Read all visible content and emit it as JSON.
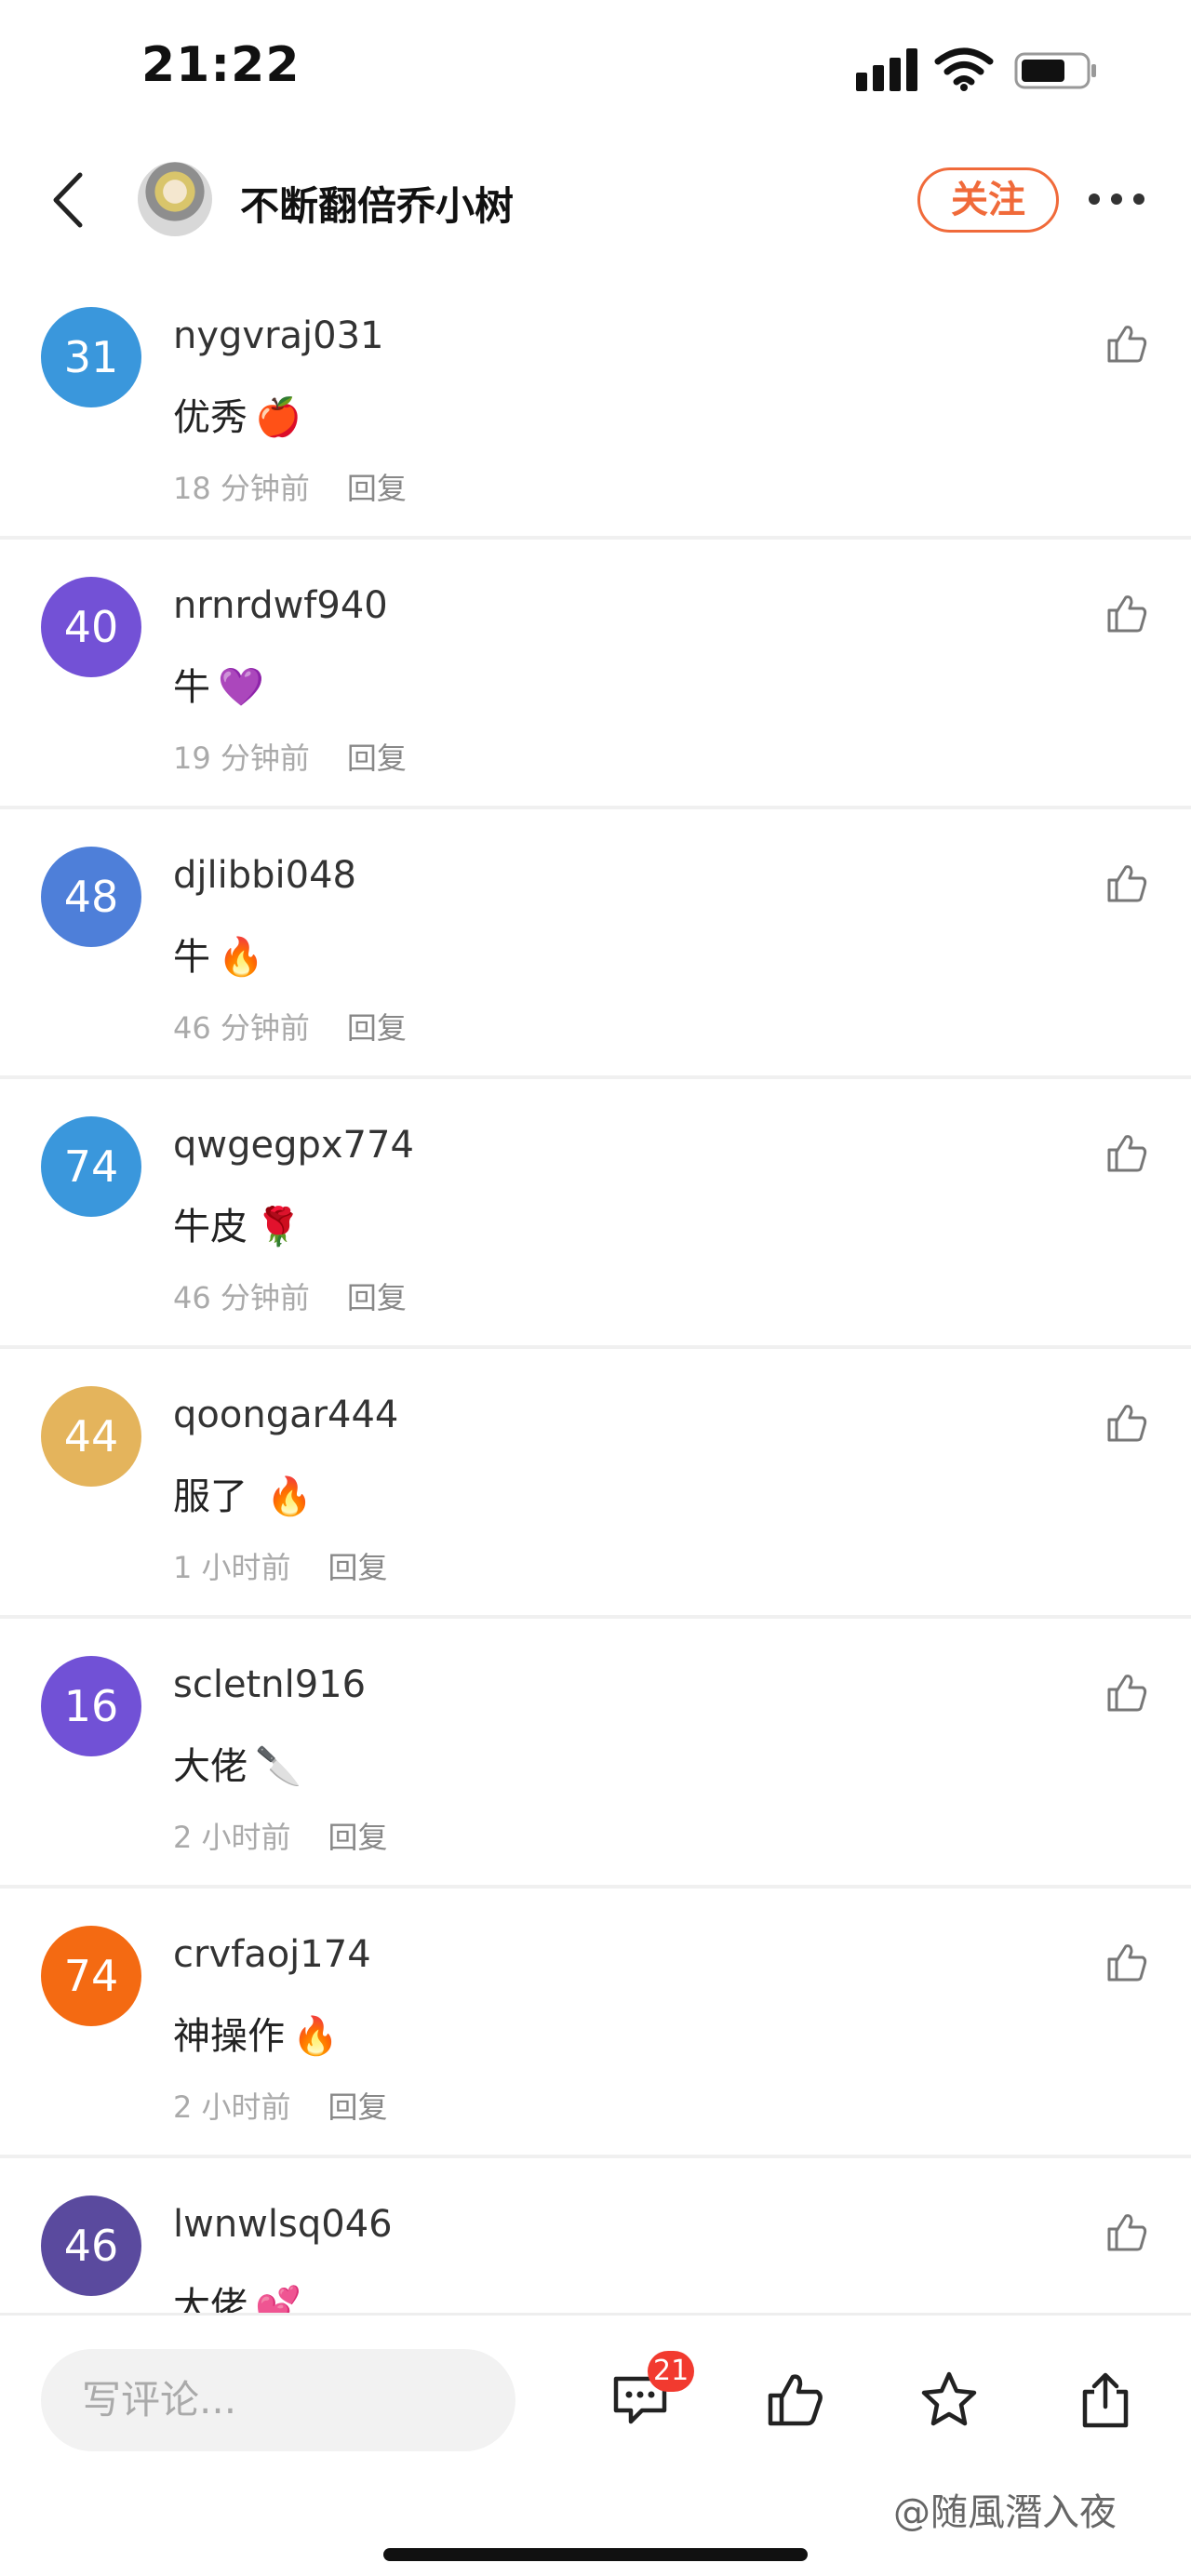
{
  "status_bar": {
    "time": "21:22"
  },
  "nav": {
    "title": "不断翻倍乔小树",
    "follow_label": "关注"
  },
  "comments": [
    {
      "avatar_number": "31",
      "avatar_color": "#3a97dc",
      "username": "nygvraj031",
      "text": "优秀",
      "emoji": "🍎",
      "time": "18 分钟前",
      "reply_label": "回复"
    },
    {
      "avatar_number": "40",
      "avatar_color": "#7351d6",
      "username": "nrnrdwf940",
      "text": "牛",
      "emoji": "💜",
      "time": "19 分钟前",
      "reply_label": "回复"
    },
    {
      "avatar_number": "48",
      "avatar_color": "#4e7fd9",
      "username": "djlibbi048",
      "text": "牛",
      "emoji": "🔥",
      "time": "46 分钟前",
      "reply_label": "回复"
    },
    {
      "avatar_number": "74",
      "avatar_color": "#3a97dc",
      "username": "qwgegpx774",
      "text": "牛皮",
      "emoji": "🌹",
      "time": "46 分钟前",
      "reply_label": "回复"
    },
    {
      "avatar_number": "44",
      "avatar_color": "#e4b45c",
      "username": "qoongar444",
      "text": "服了",
      "emoji": "🔥",
      "time": "1 小时前",
      "reply_label": "回复"
    },
    {
      "avatar_number": "16",
      "avatar_color": "#7151d6",
      "username": "scletnl916",
      "text": "大佬",
      "emoji": "🔪",
      "time": "2 小时前",
      "reply_label": "回复"
    },
    {
      "avatar_number": "74",
      "avatar_color": "#f46a12",
      "username": "crvfaoj174",
      "text": "神操作",
      "emoji": "🔥",
      "time": "2 小时前",
      "reply_label": "回复"
    },
    {
      "avatar_number": "46",
      "avatar_color": "#5a4a9e",
      "username": "lwnwlsq046",
      "text": "大佬",
      "emoji": "💕",
      "time": "",
      "reply_label": ""
    }
  ],
  "bottom_bar": {
    "input_placeholder": "写评论...",
    "comment_count_badge": "21"
  },
  "watermark": "@随風潛入夜",
  "colors": {
    "accent": "#f06a3a",
    "badge": "#f23a2f"
  }
}
